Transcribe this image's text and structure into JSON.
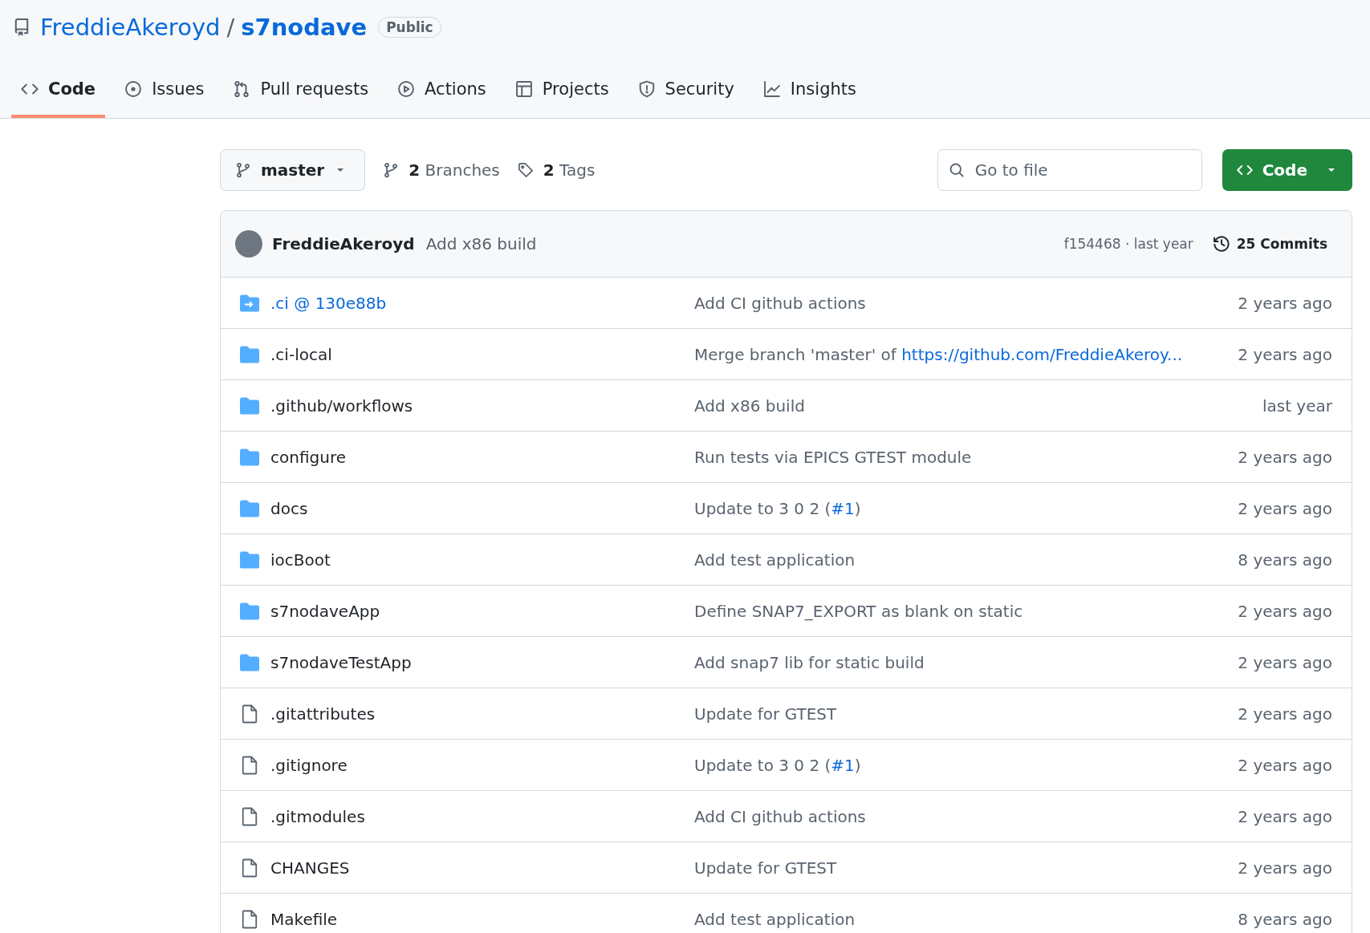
{
  "repo": {
    "owner": "FreddieAkeroyd",
    "separator": "/",
    "name": "s7nodave",
    "visibility": "Public"
  },
  "tabs": [
    {
      "label": "Code",
      "selected": true
    },
    {
      "label": "Issues",
      "selected": false
    },
    {
      "label": "Pull requests",
      "selected": false
    },
    {
      "label": "Actions",
      "selected": false
    },
    {
      "label": "Projects",
      "selected": false
    },
    {
      "label": "Security",
      "selected": false
    },
    {
      "label": "Insights",
      "selected": false
    }
  ],
  "toolbar": {
    "branch": "master",
    "branches": "2",
    "branches_label": "Branches",
    "tags": "2",
    "tags_label": "Tags",
    "search": {
      "placeholder": "Go to file"
    },
    "code_button": "Code"
  },
  "latest_commit": {
    "author": "FreddieAkeroyd",
    "message": "Add x86 build",
    "hash_time": "f154468 · last year",
    "commits": "25 Commits"
  },
  "files": [
    {
      "kind": "submodule",
      "name": ".ci @ 130e88b",
      "message": [
        {
          "kind": "plain",
          "text": "Add CI github actions"
        }
      ],
      "age": "2 years ago"
    },
    {
      "kind": "folder",
      "name": ".ci-local",
      "message": [
        {
          "kind": "plain",
          "text": "Merge branch 'master' of "
        },
        {
          "kind": "link",
          "text": "https://github.com/FreddieAkeroy..."
        }
      ],
      "age": "2 years ago"
    },
    {
      "kind": "folder",
      "name": ".github/workflows",
      "message": [
        {
          "kind": "plain",
          "text": "Add x86 build"
        }
      ],
      "age": "last year"
    },
    {
      "kind": "folder",
      "name": "configure",
      "message": [
        {
          "kind": "plain",
          "text": "Run tests via EPICS GTEST module"
        }
      ],
      "age": "2 years ago"
    },
    {
      "kind": "folder",
      "name": "docs",
      "message": [
        {
          "kind": "plain",
          "text": "Update to 3 0 2 ("
        },
        {
          "kind": "link",
          "text": "#1"
        },
        {
          "kind": "plain",
          "text": ")"
        }
      ],
      "age": "2 years ago"
    },
    {
      "kind": "folder",
      "name": "iocBoot",
      "message": [
        {
          "kind": "plain",
          "text": "Add test application"
        }
      ],
      "age": "8 years ago"
    },
    {
      "kind": "folder",
      "name": "s7nodaveApp",
      "message": [
        {
          "kind": "plain",
          "text": "Define SNAP7_EXPORT as blank on static"
        }
      ],
      "age": "2 years ago"
    },
    {
      "kind": "folder",
      "name": "s7nodaveTestApp",
      "message": [
        {
          "kind": "plain",
          "text": "Add snap7 lib for static build"
        }
      ],
      "age": "2 years ago"
    },
    {
      "kind": "file",
      "name": ".gitattributes",
      "message": [
        {
          "kind": "plain",
          "text": "Update for GTEST"
        }
      ],
      "age": "2 years ago"
    },
    {
      "kind": "file",
      "name": ".gitignore",
      "message": [
        {
          "kind": "plain",
          "text": "Update to 3 0 2 ("
        },
        {
          "kind": "link",
          "text": "#1"
        },
        {
          "kind": "plain",
          "text": ")"
        }
      ],
      "age": "2 years ago"
    },
    {
      "kind": "file",
      "name": ".gitmodules",
      "message": [
        {
          "kind": "plain",
          "text": "Add CI github actions"
        }
      ],
      "age": "2 years ago"
    },
    {
      "kind": "file",
      "name": "CHANGES",
      "message": [
        {
          "kind": "plain",
          "text": "Update for GTEST"
        }
      ],
      "age": "2 years ago"
    },
    {
      "kind": "file",
      "name": "Makefile",
      "message": [
        {
          "kind": "plain",
          "text": "Add test application"
        }
      ],
      "age": "8 years ago"
    }
  ]
}
